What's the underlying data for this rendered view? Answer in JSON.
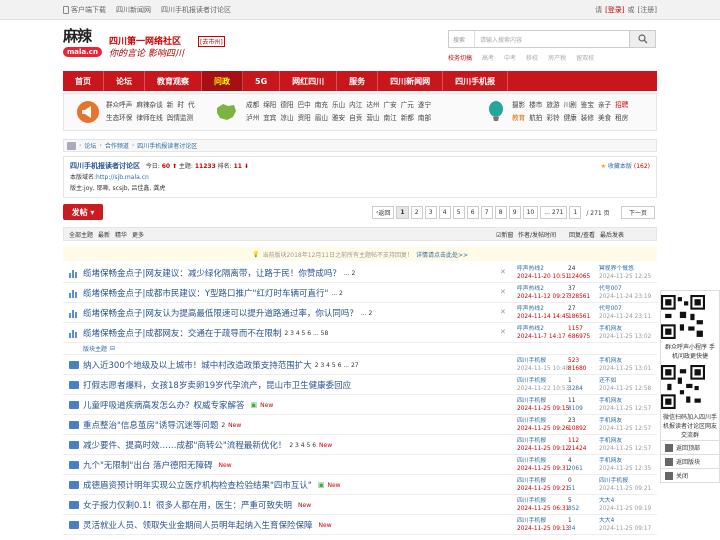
{
  "topbar": {
    "links": [
      "客户端下载",
      "四川新闻网",
      "四川手机报读者讨论区"
    ],
    "right": {
      "welcome": "请",
      "login": "[登录]",
      "or": "或",
      "register": "[注册]"
    }
  },
  "header": {
    "logo_text": "麻辣",
    "logo_sub": "mala.cn",
    "slogan1": "四川第一网络社区",
    "slogan2": "你的言论 影响四川",
    "city": "[去市州]",
    "search": {
      "select": "搜索",
      "placeholder": "请输入搜索内容"
    },
    "hot": [
      "校务切搞",
      "高考",
      "中考",
      "移校",
      "房产税",
      "留双校"
    ]
  },
  "nav": [
    {
      "label": "首页",
      "on": false
    },
    {
      "label": "论坛",
      "on": false
    },
    {
      "label": "教育观察",
      "on": false
    },
    {
      "label": "问政",
      "on": true
    },
    {
      "label": "5G",
      "on": false
    },
    {
      "label": "网红四川",
      "on": false
    },
    {
      "label": "服务",
      "on": false
    },
    {
      "label": "四川新闻网",
      "on": false
    },
    {
      "label": "四川手机报",
      "on": false
    }
  ],
  "subnav": {
    "g1": {
      "row1": [
        "群众呼声",
        "麻辣杂谈",
        "新",
        "时",
        "代"
      ],
      "row2": [
        "生态环保",
        "律师在线",
        "舆情监测"
      ]
    },
    "g2": {
      "row1": [
        "成都",
        "绵阳",
        "德阳",
        "巴中",
        "南充",
        "乐山",
        "内江",
        "达州",
        "广安",
        "广元",
        "遂宁"
      ],
      "row2": [
        "泸州",
        "宜宾",
        "凉山",
        "资阳",
        "眉山",
        "雅安",
        "自贡",
        "营山",
        "南江",
        "新都",
        "南部"
      ]
    },
    "g3": {
      "row1": [
        "摄影",
        "楼市",
        "旅游",
        "川剧",
        "鉴宝",
        "亲子",
        "招聘"
      ],
      "row2": [
        "教育",
        "航拍",
        "彩铃",
        "健康",
        "装修",
        "美食",
        "租房"
      ]
    }
  },
  "bread": [
    "论坛",
    "合作频道",
    "四川手机报读者讨论区"
  ],
  "forum": {
    "name": "四川手机报读者讨论区",
    "today_label": "今日:",
    "today": "60",
    "topics_label": "主题:",
    "topics": "11233",
    "rank_label": "排名:",
    "rank": "11",
    "domain_label": "本版域名:",
    "domain": "http://sjb.mala.cn",
    "mods_label": "版主:",
    "mods": "joy, 耶嘶, scsjb, 吕佳鑫, 龚虎",
    "fav": "收藏本版",
    "fav_count": "(162)"
  },
  "post_button": "发帖",
  "pager": {
    "prev": "返回",
    "pages": [
      "1",
      "2",
      "3",
      "4",
      "5",
      "6",
      "7",
      "8",
      "9",
      "10",
      "... 271"
    ],
    "input": "1",
    "total": "/ 271 页",
    "next": "下一页"
  },
  "thead": {
    "left": [
      "全部主题",
      "最新",
      "精华",
      "更多"
    ],
    "new": "新窗",
    "author": "作者/发帖时间",
    "reply": "回复/查看",
    "last": "最后发表"
  },
  "notice": {
    "text": "当前版块2018年12月11日之前所有主题帖不支持回复！",
    "link": "详情请点击此处>>"
  },
  "pinned": [
    {
      "title": "缆堵保畅金点子|网友建议：减少绿化隔离带，让路于民！你赞成吗？",
      "pages": "... 2",
      "author": "呼声热线2",
      "date": "2024-11-20 10:51",
      "replies": "24",
      "views": "124065",
      "last": "冥视界个慨悠",
      "ldate": "2024-11-25 12:25"
    },
    {
      "title": "缆堵保畅金点子|成都市民建议：Y型路口推广\"红灯时车辆可直行\"",
      "pages": "... 2",
      "author": "呼声热线2",
      "date": "2024-11-12 09:27",
      "replies": "37",
      "views": "328561",
      "last": "代号007",
      "ldate": "2024-11-24 23:19"
    },
    {
      "title": "缆堵保畅金点子|网友认为提高最低限速可以提升道路通过率，你认同吗？",
      "pages": "... 2",
      "author": "呼声热线2",
      "date": "2024-11-14 14:45",
      "replies": "27",
      "views": "186561",
      "last": "代号007",
      "ldate": "2024-11-24 23:11"
    },
    {
      "title": "缆堵保畅金点子|成都网友：交通在于疏导而不在限制",
      "pages": "2 3 4 5 6 ... 58",
      "author": "呼声热线2",
      "date": "2024-11-7 14:17",
      "replies": "1157",
      "views": "686975",
      "last": "手机网友",
      "ldate": "2024-11-25 13:02"
    }
  ],
  "section_label": "版块主题",
  "threads": [
    {
      "title": "纳入近300个地级及以上城市！城中村改造政策支持范围扩大",
      "pages": "2 3 4 5 6 ... 27",
      "new": "",
      "author": "四川手机报",
      "date": "2024-11-15 10:48",
      "replies": "523",
      "views": "81680",
      "last": "手机网友",
      "ldate": "2024-11-25 13:01"
    },
    {
      "title": "打假志愿者爆料，女孩18岁卖卵19岁代孕流产，昆山市卫生健康委回应",
      "pages": "",
      "new": "",
      "author": "四川手机报",
      "date": "2024-11-22 10:53",
      "replies": "1",
      "views": "3284",
      "last": "还不如",
      "ldate": "2024-11-25 12:58"
    },
    {
      "title": "儿童呼吸道疾病高发怎么办？权威专家解答",
      "pages": "",
      "new": "New",
      "author": "四川手机报",
      "date": "2024-11-25 09:15",
      "replies": "11",
      "views": "8109",
      "last": "手机网友",
      "ldate": "2024-11-25 12:57"
    },
    {
      "title": "重点整治\"信息茧房\"诱导沉迷等问题",
      "pages": "2",
      "new": "New",
      "author": "四川手机报",
      "date": "2024-11-25 09:26",
      "replies": "23",
      "views": "10892",
      "last": "手机网友",
      "ldate": "2024-11-25 12:57"
    },
    {
      "title": "减少要件、提高时效……成都\"商转公\"流程最新优化！",
      "pages": "2 3 4 5 6",
      "new": "New",
      "author": "四川手机报",
      "date": "2024-11-25 09:12",
      "replies": "112",
      "views": "21424",
      "last": "手机网友",
      "ldate": "2024-11-25 12:57"
    },
    {
      "title": "九个\"无限制\"出台 落户德阳无障碍",
      "pages": "",
      "new": "New",
      "author": "四川手机报",
      "date": "2024-11-25 09:31",
      "replies": "4",
      "views": "2061",
      "last": "手机网友",
      "ldate": "2024-11-25 12:35"
    },
    {
      "title": "成德眉资预计明年实现公立医疗机构检查检验结果\"四市互认\"",
      "pages": "",
      "new": "New",
      "author": "四川手机报",
      "date": "2024-11-25 09:21",
      "replies": "0",
      "views": "51",
      "last": "四川手机报",
      "ldate": "2024-11-25 09:21"
    },
    {
      "title": "女子报力仅剩0.1！很多人都在用，医生：严重可致失明",
      "pages": "",
      "new": "New",
      "author": "四川手机报",
      "date": "2024-11-25 06:31",
      "replies": "5",
      "views": "852",
      "last": "大大4",
      "ldate": "2024-11-25 09:19"
    },
    {
      "title": "灵活就业人员、领取失业金期间人员明年起纳入生育保险保障",
      "pages": "",
      "new": "New",
      "author": "四川手机报",
      "date": "2024-11-25 09:13",
      "replies": "1",
      "views": "34",
      "last": "大大4",
      "ldate": "2024-11-25 09:17"
    }
  ],
  "side": {
    "qr1_caption": "群众呼声小程序 手机问政更快捷",
    "qr2_caption": "微信扫码加入四川手机报读者讨论区网友交流群",
    "back": "返回顶部",
    "return": "返回版块",
    "close": "关闭"
  }
}
